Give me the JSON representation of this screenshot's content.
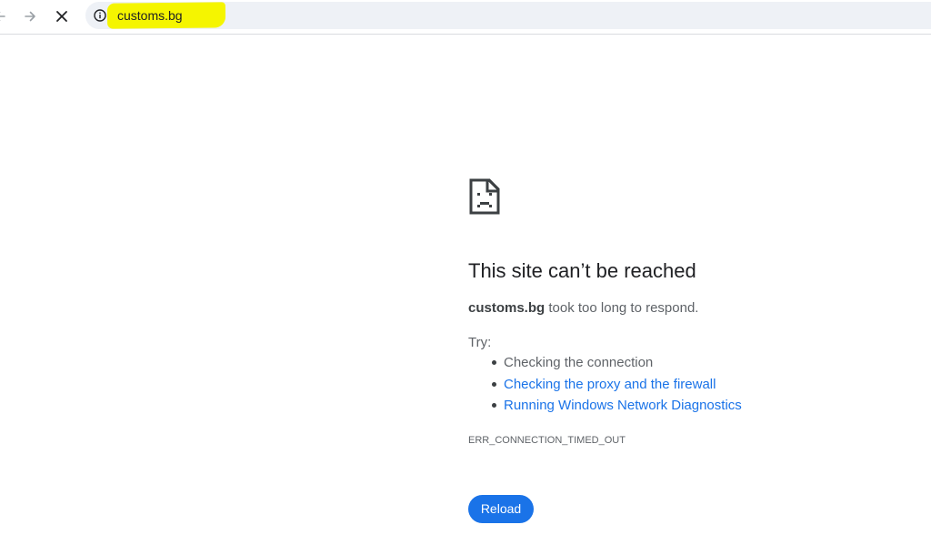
{
  "browser": {
    "url": "customs.bg",
    "icons": {
      "back": "arrow-left-icon",
      "forward": "arrow-right-icon",
      "stop": "close-icon",
      "site_info": "info-icon"
    },
    "highlight_color": "#f5f500"
  },
  "error_page": {
    "icon": "sad-page-icon",
    "heading": "This site can’t be reached",
    "summary": {
      "host": "customs.bg",
      "message": " took too long to respond."
    },
    "try_label": "Try:",
    "suggestions": [
      {
        "label": "Checking the connection",
        "is_link": false
      },
      {
        "label": "Checking the proxy and the firewall",
        "is_link": true
      },
      {
        "label": "Running Windows Network Diagnostics",
        "is_link": true
      }
    ],
    "error_code": "ERR_CONNECTION_TIMED_OUT",
    "reload_label": "Reload",
    "colors": {
      "link": "#1a73e8",
      "button": "#1a73e8",
      "heading": "#202124"
    }
  }
}
